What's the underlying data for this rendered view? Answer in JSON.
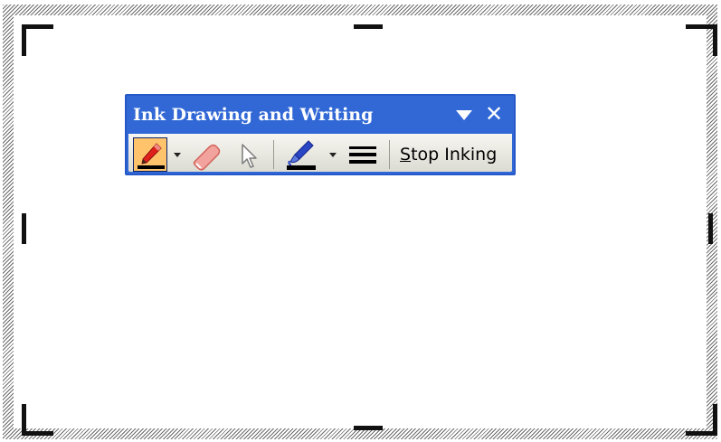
{
  "toolbar": {
    "title": "Ink Drawing and Writing",
    "close_glyph": "✕",
    "stop_inking_accel": "S",
    "stop_inking_rest": "top Inking",
    "tools": [
      {
        "name": "pen",
        "icon": "pen-icon",
        "selected": true,
        "color": "#e0211b"
      },
      {
        "name": "eraser",
        "icon": "eraser-icon"
      },
      {
        "name": "select-objects",
        "icon": "arrow-pointer-icon"
      },
      {
        "name": "ink-color",
        "icon": "ink-color-icon",
        "color": "#2a46c4"
      },
      {
        "name": "line-style",
        "icon": "line-thickness-icon"
      }
    ]
  },
  "colors": {
    "title_bar": "#3168d5",
    "selected_tool": "#ffc36b",
    "frame_hatch": "#6a6a6a"
  }
}
